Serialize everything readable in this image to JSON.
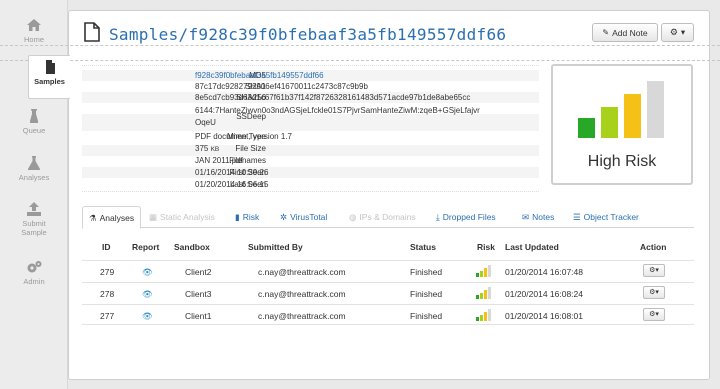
{
  "sidebar": {
    "items": [
      {
        "label": "Home",
        "icon": "home-icon"
      },
      {
        "label": "Samples",
        "icon": "file-icon",
        "active": true
      },
      {
        "label": "Queue",
        "icon": "queue-icon"
      },
      {
        "label": "Analyses",
        "icon": "flask-icon"
      },
      {
        "label": "Submit Sample",
        "icon": "upload-icon"
      },
      {
        "label": "Admin",
        "icon": "gears-icon"
      }
    ]
  },
  "header": {
    "title": "Samples/f928c39f0bfebaaf3a5fb149557ddf66",
    "add_note": "Add Note",
    "gear_caret": "▾"
  },
  "meta": [
    {
      "key": "MD5",
      "value": "f928c39f0bfebaaf3a5fb149557ddf66",
      "link": true
    },
    {
      "key": "SHA1",
      "value": "87c17dc9282792906ef41670011c2473c87c9b9b"
    },
    {
      "key": "SHA256",
      "value": "8e5cd7cb93d63d1c67f61b37f142f8726328161483d571acde97b1de8abe65cc"
    },
    {
      "key": "SSDeep",
      "value": "6144:7HanteZiwvn0o3ndAGSjeLfckle01S7PjvrSamHanteZiwM:zqeB+GSjeLfajvr",
      "value2": "OqeU"
    },
    {
      "key": "Mime Type",
      "value": "PDF document, version 1.7"
    },
    {
      "key": "File Size",
      "value": "375",
      "unit": "KB"
    },
    {
      "key": "Filenames",
      "value": "JAN 2011.pdf"
    },
    {
      "key": "First Seen",
      "value": "01/16/2014 10:39:26"
    },
    {
      "key": "Last Seen",
      "value": "01/20/2014 16:06:15"
    }
  ],
  "risk": {
    "label": "High Risk",
    "bars": [
      {
        "color": "#27a827",
        "level": 0.35
      },
      {
        "color": "#a8d11c",
        "level": 0.55
      },
      {
        "color": "#f6c117",
        "level": 0.78
      },
      {
        "color": "#d8d8d8",
        "level": 1.0
      }
    ]
  },
  "tabs": [
    {
      "label": "Analyses",
      "icon": "flask-icon",
      "glyph": "⚗",
      "state": "active"
    },
    {
      "label": "Static Analysis",
      "icon": "grid-icon",
      "glyph": "▦",
      "state": "disabled"
    },
    {
      "label": "Risk",
      "icon": "bar-chart-icon",
      "glyph": "▮",
      "state": "link"
    },
    {
      "label": "VirusTotal",
      "icon": "cog-icon",
      "glyph": "✲",
      "state": "link"
    },
    {
      "label": "IPs & Domains",
      "icon": "globe-icon",
      "glyph": "◍",
      "state": "disabled"
    },
    {
      "label": "Dropped Files",
      "icon": "download-icon",
      "glyph": "⤓",
      "state": "link"
    },
    {
      "label": "Notes",
      "icon": "comments-icon",
      "glyph": "✉",
      "state": "link"
    },
    {
      "label": "Object Tracker",
      "icon": "list-icon",
      "glyph": "☰",
      "state": "link"
    }
  ],
  "table": {
    "headers": [
      "ID",
      "Report",
      "Sandbox",
      "Submitted By",
      "Status",
      "Risk",
      "Last Updated",
      "Action"
    ],
    "rows": [
      {
        "id": "279",
        "sandbox": "Client2",
        "submitted_by": "c.nay@threattrack.com",
        "status": "Finished",
        "last_updated": "01/20/2014 16:07:48"
      },
      {
        "id": "278",
        "sandbox": "Client3",
        "submitted_by": "c.nay@threattrack.com",
        "status": "Finished",
        "last_updated": "01/20/2014 16:08:24"
      },
      {
        "id": "277",
        "sandbox": "Client1",
        "submitted_by": "c.nay@threattrack.com",
        "status": "Finished",
        "last_updated": "01/20/2014 16:08:01"
      }
    ]
  },
  "colors": {
    "accent": "#2a6fb0",
    "eye": "#2a8fc7"
  }
}
